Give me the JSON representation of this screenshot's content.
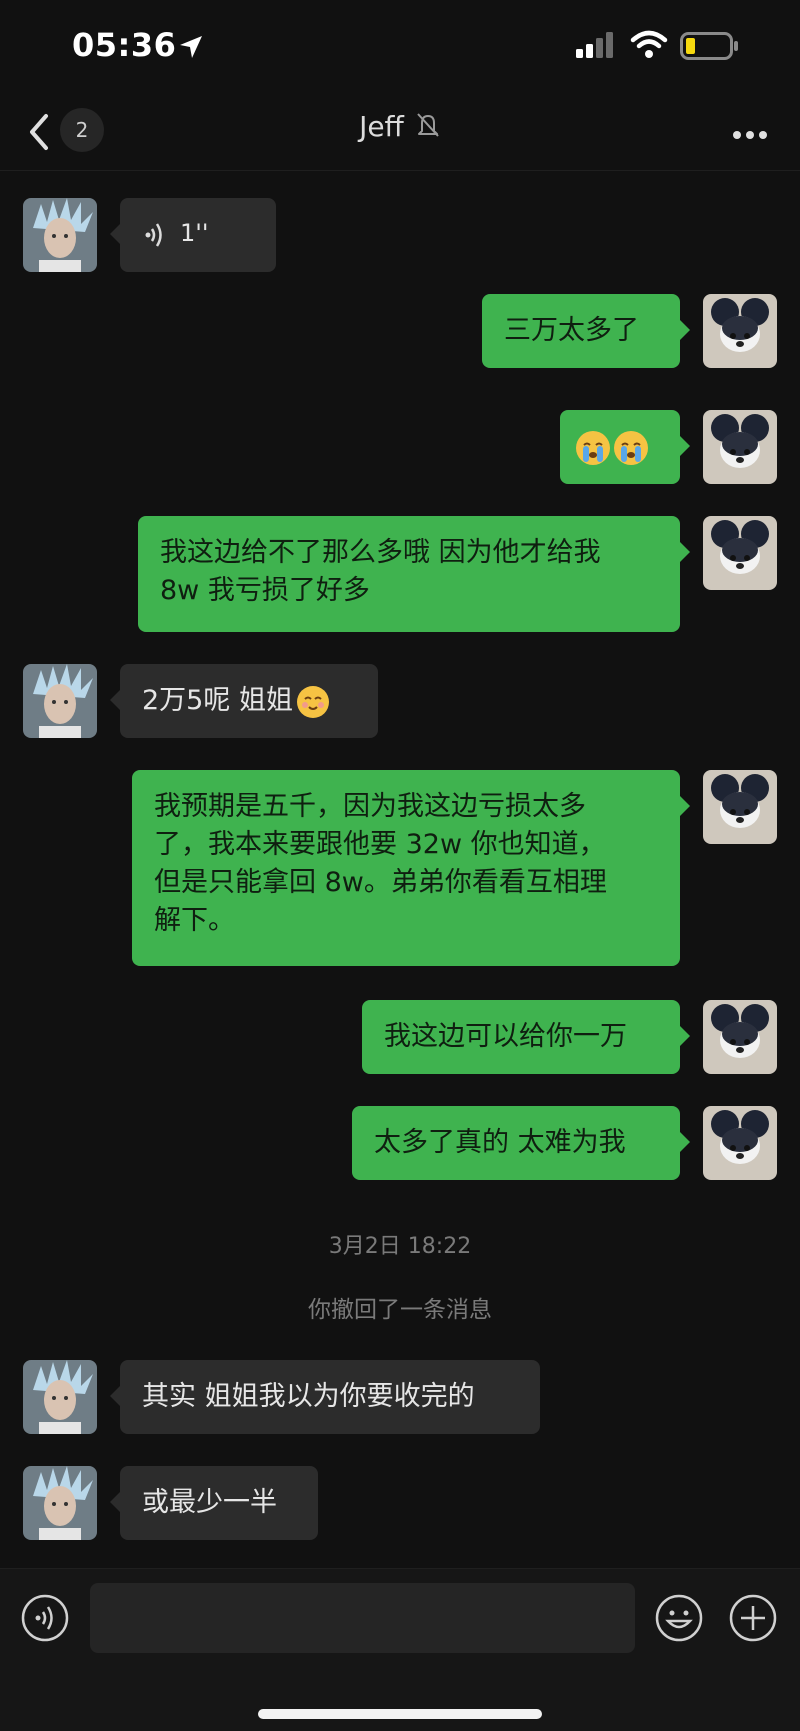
{
  "status_bar": {
    "time": "05:36"
  },
  "header": {
    "back_badge": "2",
    "title": "Jeff"
  },
  "messages": {
    "m1": {
      "voice_duration": "1''"
    },
    "m2": {
      "text": "三万太多了"
    },
    "m3": {
      "emoji": "crying-face crying-face"
    },
    "m4": {
      "line1": "我这边给不了那么多哦 因为他才给我",
      "line2": "8w 我亏损了好多"
    },
    "m5": {
      "text": "2万5呢 姐姐"
    },
    "m6": {
      "line1": "我预期是五千，因为我这边亏损太多",
      "line2": "了，我本来要跟他要 32w 你也知道，",
      "line3": "但是只能拿回 8w。弟弟你看看互相理",
      "line4": "解下。"
    },
    "m7": {
      "text": "我这边可以给你一万"
    },
    "m8": {
      "text": "太多了真的 太难为我"
    },
    "timestamp": "3月2日 18:22",
    "system": "你撤回了一条消息",
    "m9": {
      "text": "其实 姐姐我以为你要收完的"
    },
    "m10": {
      "text": "或最少一半"
    }
  },
  "input": {
    "value": ""
  },
  "colors": {
    "outgoing_bubble": "#3fb34f",
    "incoming_bubble": "#2c2c2c",
    "background": "#111111"
  }
}
